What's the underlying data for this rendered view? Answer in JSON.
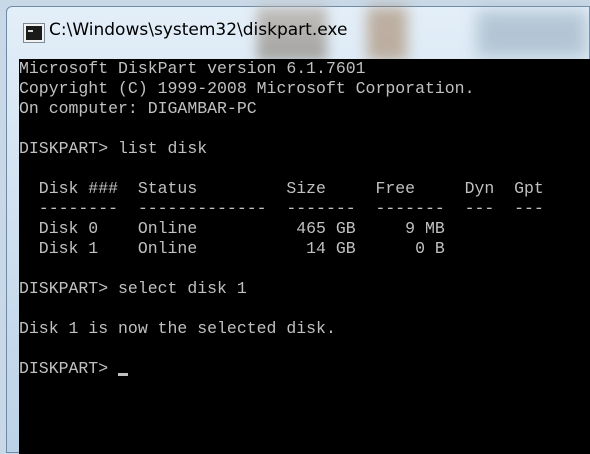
{
  "window": {
    "title": "C:\\Windows\\system32\\diskpart.exe"
  },
  "console": {
    "lines": [
      "Microsoft DiskPart version 6.1.7601",
      "Copyright (C) 1999-2008 Microsoft Corporation.",
      "On computer: DIGAMBAR-PC",
      "",
      "DISKPART> list disk",
      "",
      "  Disk ###  Status         Size     Free     Dyn  Gpt",
      "  --------  -------------  -------  -------  ---  ---",
      "  Disk 0    Online          465 GB     9 MB",
      "  Disk 1    Online           14 GB      0 B",
      "",
      "DISKPART> select disk 1",
      "",
      "Disk 1 is now the selected disk.",
      "",
      "DISKPART> "
    ]
  }
}
